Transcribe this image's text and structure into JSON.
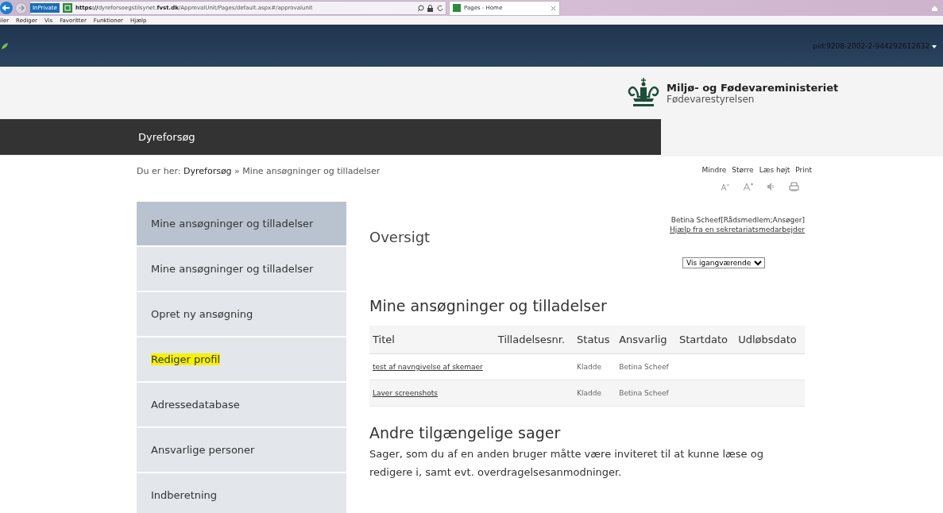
{
  "browser": {
    "private_badge": "InPrivate",
    "url_prefix": "https://",
    "url_path_start": "dyreforsoegstilsynet.",
    "url_domain": "fvst.dk",
    "url_rest": "/ApprovalUnit/Pages/default.aspx#/approvalunit",
    "tab_title": "Pages - Home",
    "menu": [
      "iler",
      "Rediger",
      "Vis",
      "Favoritter",
      "Funktioner",
      "Hjælp"
    ]
  },
  "top_bar": {
    "user_id": "pid:9208-2002-2-944292612632"
  },
  "brand": {
    "ministry": "Miljø- og Fødevareministeriet",
    "agency": "Fødevarestyrelsen"
  },
  "nav": {
    "title": "Dyreforsøg"
  },
  "breadcrumb": {
    "prefix": "Du er her:",
    "parent": "Dyreforsøg",
    "separator": "»",
    "current": "Mine ansøgninger og tilladelser"
  },
  "tools": [
    {
      "label": "Mindre",
      "kind": "smaller"
    },
    {
      "label": "Større",
      "kind": "larger"
    },
    {
      "label": "Læs højt",
      "kind": "speak"
    },
    {
      "label": "Print",
      "kind": "print"
    }
  ],
  "sidebar": {
    "items": [
      {
        "label": "Mine ansøgninger og tilladelser",
        "selected": true,
        "highlighted": false
      },
      {
        "label": "Mine ansøgninger og tilladelser",
        "selected": false,
        "highlighted": false
      },
      {
        "label": "Opret ny ansøgning",
        "selected": false,
        "highlighted": false
      },
      {
        "label": "Rediger profil",
        "selected": false,
        "highlighted": true
      },
      {
        "label": "Adressedatabase",
        "selected": false,
        "highlighted": false
      },
      {
        "label": "Ansvarlige personer",
        "selected": false,
        "highlighted": false
      },
      {
        "label": "Indberetning",
        "selected": false,
        "highlighted": false
      }
    ]
  },
  "main": {
    "title": "Oversigt",
    "user": "Betina Scheef[Rådsmedlem;Ansøger]",
    "help_link": "Hjælp fra en sekretariatsmedarbejder",
    "filter": "Vis igangværende",
    "applications": {
      "heading": "Mine ansøgninger og tilladelser",
      "columns": [
        "Titel",
        "Tilladelsesnr.",
        "Status",
        "Ansvarlig",
        "Startdato",
        "Udløbsdato"
      ],
      "rows": [
        {
          "title": "test af navngivelse af skemaer",
          "status": "Kladde",
          "responsible": "Betina Scheef"
        },
        {
          "title": "Laver screenshots",
          "status": "Kladde",
          "responsible": "Betina Scheef"
        }
      ]
    },
    "other": {
      "heading": "Andre tilgængelige sager",
      "text": "Sager, som du af en anden bruger måtte være inviteret til at kunne læse og redigere i, samt evt. overdragelsesanmodninger."
    }
  }
}
